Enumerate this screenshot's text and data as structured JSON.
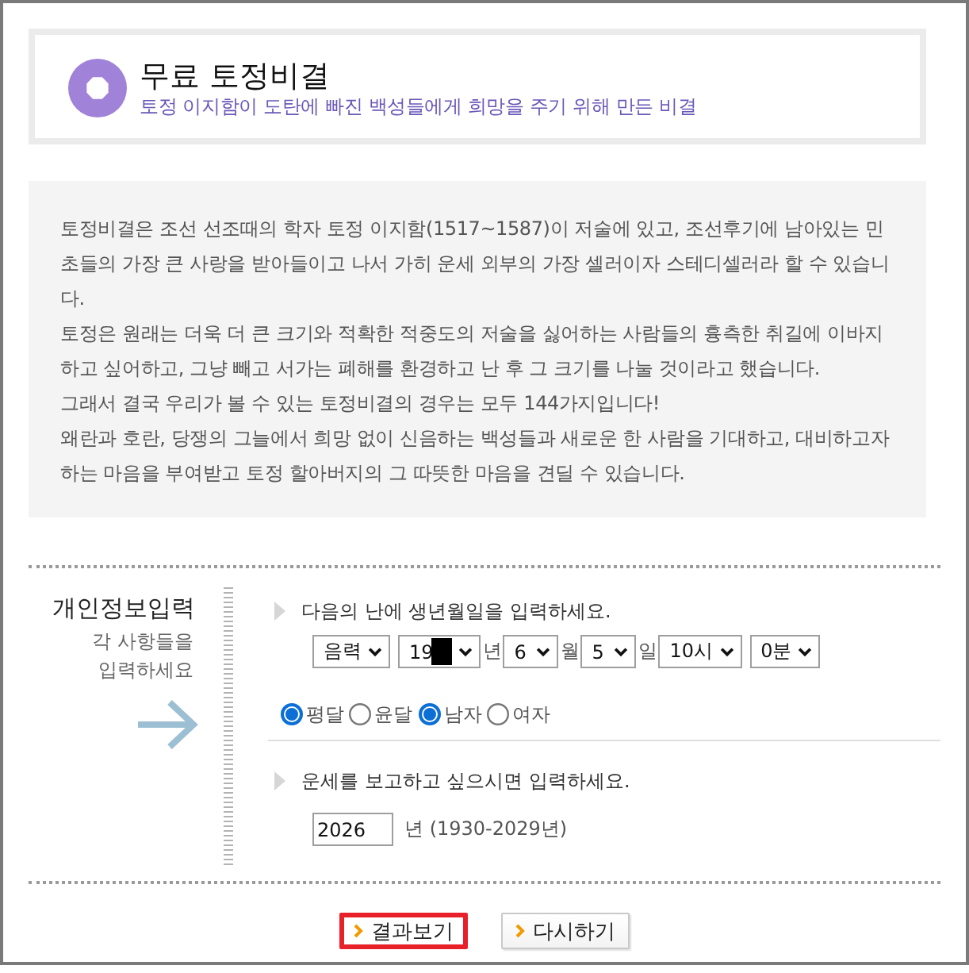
{
  "header": {
    "title": "무료 토정비결",
    "subtitle": "토정 이지함이 도탄에 빠진 백성들에게 희망을 주기 위해 만든 비결"
  },
  "intro": {
    "paragraphs": [
      "토정비결은 조선 선조때의 학자 토정 이지함(1517~1587)이 저술에 있고, 조선후기에 남아있는 민초들의 가장 큰 사랑을 받아들이고 나서 가히 운세 외부의 가장 셀러이자 스테디셀러라 할 수 있습니다.",
      "토정은 원래는 더욱 더 큰 크기와 적확한 적중도의 저술을 싫어하는 사람들의 흉측한 취길에 이바지하고 싶어하고, 그냥 빼고 서가는 폐해를 환경하고 난 후 그 크기를 나눌 것이라고 했습니다.",
      "그래서 결국 우리가 볼 수 있는 토정비결의 경우는 모두 144가지입니다!",
      "왜란과 호란, 당쟁의 그늘에서 희망 없이 신음하는 백성들과 새로운 한 사람을 기대하고, 대비하고자 하는 마음을 부여받고 토정 할아버지의 그 따뜻한 마음을 견딜 수 있습니다."
    ]
  },
  "form": {
    "title": "개인정보입력",
    "hint": "각 사항들을 입력하세요",
    "sections": [
      {
        "prompt": "다음의 난에 생년월일을 입력하세요.",
        "selects": [
          {
            "value": "음력"
          },
          {
            "value": "19",
            "redacted": true,
            "unit": "년"
          },
          {
            "value": "6",
            "unit": "월"
          },
          {
            "value": "5",
            "unit": "일"
          },
          {
            "value": "10시"
          },
          {
            "value": "0분"
          }
        ],
        "radio_groups": [
          [
            {
              "label": "평달",
              "selected": true
            },
            {
              "label": "윤달",
              "selected": false
            }
          ],
          [
            {
              "label": "남자",
              "selected": true
            },
            {
              "label": "여자",
              "selected": false
            }
          ]
        ]
      },
      {
        "prompt": "운세를 보고하고 싶으시면 입력하세요.",
        "year_input": {
          "value": "2026",
          "unit": "년 (1930-2029년)"
        }
      }
    ]
  },
  "buttons": [
    {
      "label": "결과보기",
      "highlighted": true
    },
    {
      "label": "다시하기",
      "highlighted": false
    }
  ]
}
